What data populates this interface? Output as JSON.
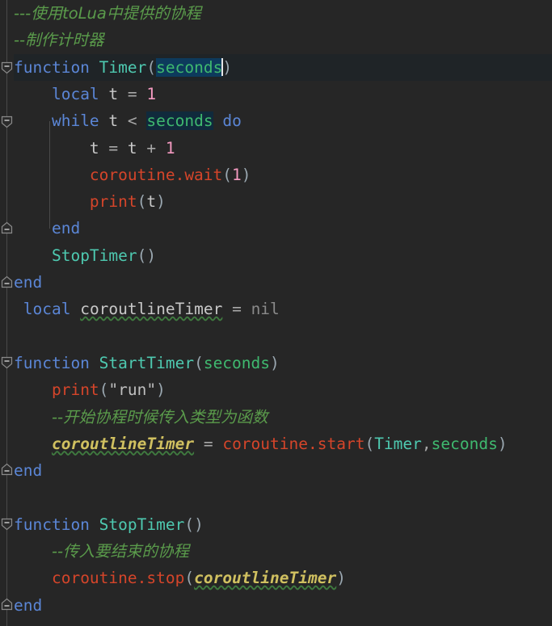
{
  "editor": {
    "language": "lua",
    "theme": "dark",
    "background_color": "#262626",
    "current_line_color": "#1f2427",
    "gutter_color": "#262626",
    "selection_color": "#0d3a5c",
    "caret_color": "#e6e6e6",
    "caret_line_number": 3,
    "selected_text": "seconds",
    "font_size_px": 19.5,
    "line_height_px": 33.3
  },
  "palette": {
    "keyword": "#5b86d6",
    "function_name": "#4ec9b0",
    "parameter": "#3fb96f",
    "identifier": "#c8c8c8",
    "library_call": "#d5452a",
    "number": "#f49ac1",
    "nil_literal": "#8a8a8a",
    "string": "#bfbfbf",
    "comment": "#5a9b4b",
    "field_variable": "#d0c060",
    "spellcheck_squiggle": "#3f7a3f",
    "indent_guide": "#4a4a4a"
  },
  "fold_markers": [
    {
      "line": 3,
      "state": "expanded",
      "direction": "down"
    },
    {
      "line": 5,
      "state": "expanded",
      "direction": "down"
    },
    {
      "line": 9,
      "state": "expanded",
      "direction": "up"
    },
    {
      "line": 11,
      "state": "expanded",
      "direction": "up"
    },
    {
      "line": 14,
      "state": "expanded",
      "direction": "down"
    },
    {
      "line": 18,
      "state": "expanded",
      "direction": "up"
    },
    {
      "line": 20,
      "state": "expanded",
      "direction": "down"
    },
    {
      "line": 23,
      "state": "expanded",
      "direction": "up"
    }
  ],
  "code_lines": [
    {
      "n": 1,
      "text": "---使用toLua中提供的协程"
    },
    {
      "n": 2,
      "text": "--制作计时器"
    },
    {
      "n": 3,
      "text": "function Timer(seconds)"
    },
    {
      "n": 4,
      "text": "    local t = 1"
    },
    {
      "n": 5,
      "text": "    while t < seconds do"
    },
    {
      "n": 6,
      "text": "        t = t + 1"
    },
    {
      "n": 7,
      "text": "        coroutine.wait(1)"
    },
    {
      "n": 8,
      "text": "        print(t)"
    },
    {
      "n": 9,
      "text": "    end"
    },
    {
      "n": 10,
      "text": "    StopTimer()"
    },
    {
      "n": 11,
      "text": "end"
    },
    {
      "n": 12,
      "text": " local coroutlineTimer = nil"
    },
    {
      "n": 13,
      "text": ""
    },
    {
      "n": 14,
      "text": "function StartTimer(seconds)"
    },
    {
      "n": 15,
      "text": "    print(\"run\")"
    },
    {
      "n": 16,
      "text": "    --开始协程时候传入类型为函数"
    },
    {
      "n": 17,
      "text": "    coroutlineTimer = coroutine.start(Timer,seconds)"
    },
    {
      "n": 18,
      "text": "end"
    },
    {
      "n": 19,
      "text": ""
    },
    {
      "n": 20,
      "text": "function StopTimer()"
    },
    {
      "n": 21,
      "text": "    --传入要结束的协程"
    },
    {
      "n": 22,
      "text": "    coroutine.stop(coroutlineTimer)"
    },
    {
      "n": 23,
      "text": "end"
    }
  ],
  "tokens": {
    "kw_function": "function",
    "kw_local": "local",
    "kw_while": "while",
    "kw_do": "do",
    "kw_end": "end",
    "fn_timer": "Timer",
    "fn_start_timer": "StartTimer",
    "fn_stop_timer": "StopTimer",
    "param_seconds": "seconds",
    "var_t": "t",
    "var_coroutline_timer": "coroutlineTimer",
    "lib_coroutine_wait": "coroutine.wait",
    "lib_coroutine_start": "coroutine.start",
    "lib_coroutine_stop": "coroutine.stop",
    "lib_print": "print",
    "num_one": "1",
    "lit_nil": "nil",
    "str_run": "\"run\"",
    "op_assign": "=",
    "op_lt": "<",
    "op_plus": "+",
    "comma": ",",
    "paren_open": "(",
    "paren_close": ")",
    "comment_1": "---使用toLua中提供的协程",
    "comment_2": "--制作计时器",
    "comment_3": "--开始协程时候传入类型为函数",
    "comment_4": "--传入要结束的协程"
  }
}
